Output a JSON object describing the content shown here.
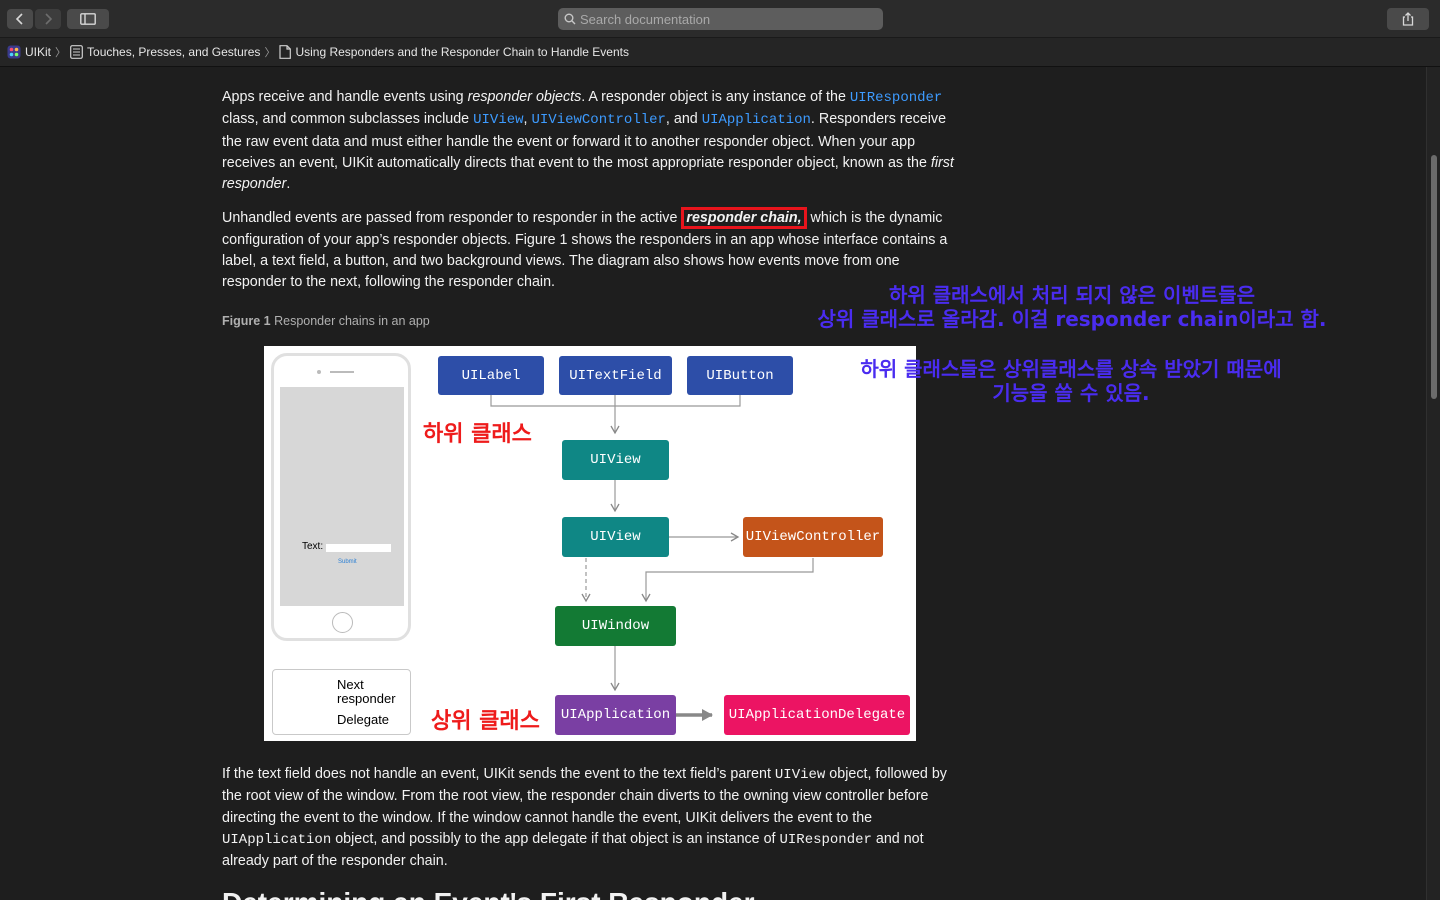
{
  "toolbar": {
    "search_placeholder": "Search documentation",
    "back_icon": "chevron-left-icon",
    "forward_icon": "chevron-right-icon",
    "sidebar_icon": "sidebar-toggle-icon",
    "share_icon": "share-icon"
  },
  "breadcrumb": {
    "items": [
      {
        "label": "UIKit",
        "icon": "framework-icon"
      },
      {
        "label": "Touches, Presses, and Gestures",
        "icon": "collection-icon"
      },
      {
        "label": "Using Responders and the Responder Chain to Handle Events",
        "icon": "article-icon"
      }
    ]
  },
  "article": {
    "p1": {
      "t1": "Apps receive and handle events using ",
      "em1": "responder objects",
      "t2": ". A responder object is any instance of the ",
      "code1": "UIResponder",
      "t3": " class, and common subclasses include ",
      "code2": "UIView",
      "t4": ", ",
      "code3": "UIViewController",
      "t5": ", and ",
      "code4": "UIApplication",
      "t6": ". Responders receive the raw event data and must either handle the event or forward it to another responder object. When your app receives an event, UIKit automatically directs that event to the most appropriate responder object, known as the ",
      "em2": "first responder",
      "t7": "."
    },
    "p2": {
      "t1": "Unhandled events are passed from responder to responder in the active ",
      "em1": "responder chain,",
      "t2": " which is the dynamic configuration of your app’s responder objects. Figure 1 shows the responders in an app whose interface contains a label, a text field, a button, and two background views. The diagram also shows how events move from one responder to the next, following the responder chain."
    },
    "figure_caption": {
      "label": "Figure 1",
      "text": " Responder chains in an app"
    },
    "p3": {
      "t1": "If the text field does not handle an event, UIKit sends the event to the text field’s parent ",
      "code1": "UIView",
      "t2": " object, followed by the root view of the window. From the root view, the responder chain diverts to the owning view controller before directing the event to the window. If the window cannot handle the event, UIKit delivers the event to the ",
      "code2": "UIApplication",
      "t3": " object, and possibly to the app delegate if that object is an instance of ",
      "code3": "UIResponder",
      "t4": " and not already part of the responder chain."
    },
    "next_heading": "Determining an Event's First Responder"
  },
  "diagram": {
    "phone": {
      "text_label": "Text:",
      "submit_label": "Submit"
    },
    "nodes": {
      "uilabel": "UILabel",
      "uitextfield": "UITextField",
      "uibutton": "UIButton",
      "uiview1": "UIView",
      "uiview2": "UIView",
      "uiviewcontroller": "UIViewController",
      "uiwindow": "UIWindow",
      "uiapplication": "UIApplication",
      "uiappdelegate": "UIApplicationDelegate"
    },
    "legend": {
      "next_responder": "Next\nresponder",
      "delegate": "Delegate"
    }
  },
  "annotations": {
    "subclass_label": "하위 클래스",
    "superclass_label": "상위 클래스",
    "note1_line1": "하위 클래스에서 처리 되지 않은 이벤트들은",
    "note1_line2": "상위 클래스로 올라감. 이걸 responder chain이라고 함.",
    "note2_line1": "하위 클래스들은 상위클래스를 상속 받았기 때문에",
    "note2_line2": "기능을 쓸 수 있음.",
    "annotation_red": "#ee1b1b",
    "annotation_blue": "#4a2cf0"
  },
  "colors": {
    "link": "#3d9bff",
    "node_blue": "#2d4ea8",
    "node_teal": "#0f8785",
    "node_orange": "#c4541a",
    "node_green": "#137a34",
    "node_purple": "#7a3fa3",
    "node_pink": "#ec1463"
  }
}
